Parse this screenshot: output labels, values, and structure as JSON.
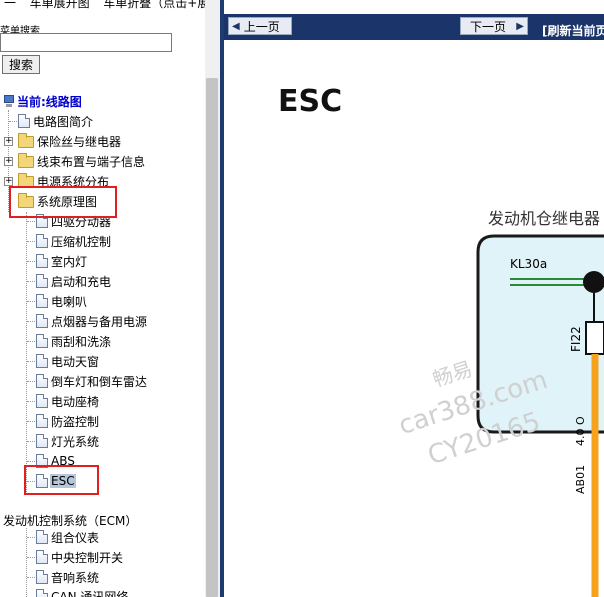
{
  "sidebar": {
    "top_text": "一 ¯ 车单展开图 ¯ 车单折叠（点击+展",
    "search_label": "菜单搜索",
    "search_value": "",
    "search_button": "搜索",
    "current_title": "当前:线路图",
    "items": [
      {
        "label": "电路图简介",
        "type": "doc"
      },
      {
        "label": "保险丝与继电器",
        "type": "folder"
      },
      {
        "label": "线束布置与端子信息",
        "type": "folder"
      },
      {
        "label": "电源系统分布",
        "type": "folder"
      },
      {
        "label": "系统原理图",
        "type": "folder"
      },
      {
        "label": "四驱分动器",
        "type": "doc"
      },
      {
        "label": "压缩机控制",
        "type": "doc"
      },
      {
        "label": "室内灯",
        "type": "doc"
      },
      {
        "label": "启动和充电",
        "type": "doc"
      },
      {
        "label": "电喇叭",
        "type": "doc"
      },
      {
        "label": "点烟器与备用电源",
        "type": "doc"
      },
      {
        "label": "雨刮和洗涤",
        "type": "doc"
      },
      {
        "label": "电动天窗",
        "type": "doc"
      },
      {
        "label": "倒车灯和倒车雷达",
        "type": "doc"
      },
      {
        "label": "电动座椅",
        "type": "doc"
      },
      {
        "label": "防盗控制",
        "type": "doc"
      },
      {
        "label": "灯光系统",
        "type": "doc"
      },
      {
        "label": "ABS",
        "type": "doc"
      },
      {
        "label": "ESC",
        "type": "doc"
      },
      {
        "label": "发动机控制系统（ECM）",
        "type": "text"
      },
      {
        "label": "组合仪表",
        "type": "doc"
      },
      {
        "label": "中央控制开关",
        "type": "doc"
      },
      {
        "label": "音响系统",
        "type": "doc"
      },
      {
        "label": "CAN 通讯网络",
        "type": "doc"
      }
    ],
    "expand_symbol": "+"
  },
  "nav": {
    "prev": "上一页",
    "next": "下一页",
    "refresh": "[刷新当前页"
  },
  "page": {
    "heading": "ESC",
    "diagram_title": "发动机仓继电器",
    "wire_kl30a": "KL30a",
    "fuse_label": "FI22",
    "wire_spec": "4.0 O",
    "connector_label": "AB01"
  },
  "watermark": {
    "line1": "畅易",
    "line2": "car388.com",
    "line3": "CY20165"
  },
  "colors": {
    "nav_bar": "#1b3469",
    "highlight_box": "#e02020",
    "selection": "#b6c6db",
    "wire_orange": "#f5a21f",
    "diagram_fill": "#dff3f8"
  }
}
